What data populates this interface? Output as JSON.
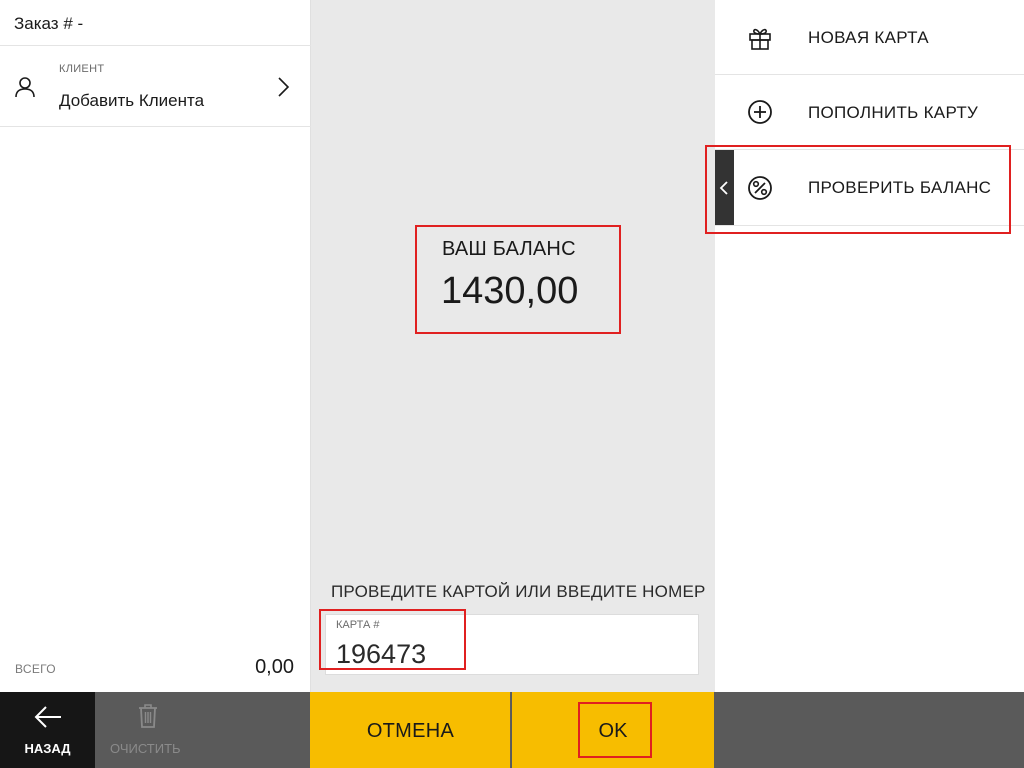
{
  "order": {
    "title": "Заказ  # -"
  },
  "client": {
    "label": "КЛИЕНТ",
    "value": "Добавить Клиента"
  },
  "total": {
    "label": "ВСЕГО",
    "value": "0,00"
  },
  "balance": {
    "label": "ВАШ БАЛАНС",
    "value": "1430,00"
  },
  "card": {
    "hint": "ПРОВЕДИТЕ КАРТОЙ ИЛИ ВВЕДИТЕ НОМЕР",
    "label": "КАРТА #",
    "value": "196473"
  },
  "menu": {
    "items": [
      {
        "label": "НОВАЯ КАРТА",
        "icon": "gift-icon"
      },
      {
        "label": "ПОПОЛНИТЬ КАРТУ",
        "icon": "plus-circle-icon"
      },
      {
        "label": "ПРОВЕРИТЬ БАЛАНС",
        "icon": "percent-circle-icon",
        "active": true
      }
    ]
  },
  "bottom": {
    "back_label": "НАЗАД",
    "clear_label": "ОЧИСТИТЬ",
    "cancel_label": "ОТМЕНА",
    "ok_label": "OK"
  },
  "colors": {
    "accent": "#f7bd00",
    "highlight": "#e02020",
    "back": "#161616",
    "bar": "#5a5a5a",
    "center_bg": "#e9e9e9"
  }
}
